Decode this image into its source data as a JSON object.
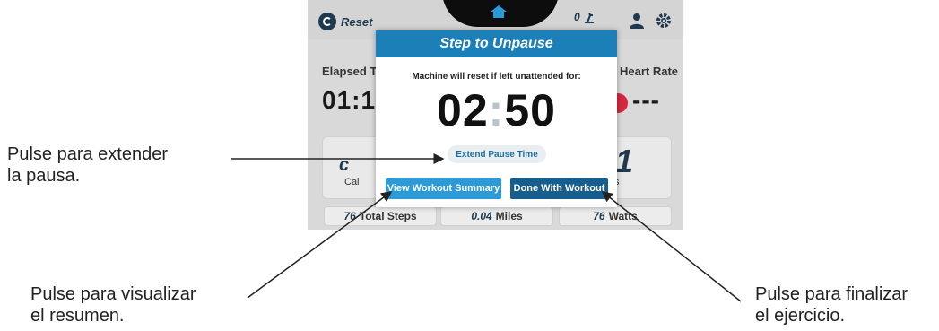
{
  "callouts": {
    "extend": [
      "Pulse para extender",
      "la pausa."
    ],
    "summary": [
      "Pulse para visualizar",
      "el resumen."
    ],
    "finish": [
      "Pulse para finalizar",
      "el ejercicio."
    ]
  },
  "screen": {
    "reset_label": "Reset",
    "counter": "0",
    "elapsed_label": "Elapsed Ti",
    "elapsed_value": "01:1",
    "heart_rate_label": "Heart Rate",
    "heart_rate_value": "---",
    "left_card_number": "c",
    "left_card_label": "Cal",
    "right_card_number": "1",
    "right_card_label": "ts",
    "steps_value": "76",
    "steps_label": "Total Steps",
    "miles_value": "0.04",
    "miles_label": "Miles",
    "watts_value": "76",
    "watts_label": "Watts"
  },
  "modal": {
    "title": "Step to Unpause",
    "subtitle": "Machine will reset if left unattended for:",
    "minutes": "02",
    "separator": ":",
    "seconds": "50",
    "extend_label": "Extend Pause Time",
    "summary_label": "View Workout Summary",
    "done_label": "Done With Workout"
  },
  "icons": [
    "reset-icon",
    "home-icon",
    "walker-icon",
    "profile-icon",
    "gear-icon"
  ],
  "colors": {
    "modal_header": "#1d7fb8",
    "summary_button": "#2a9ad8",
    "done_button": "#155e8d",
    "heart_rate": "#d7263d"
  }
}
